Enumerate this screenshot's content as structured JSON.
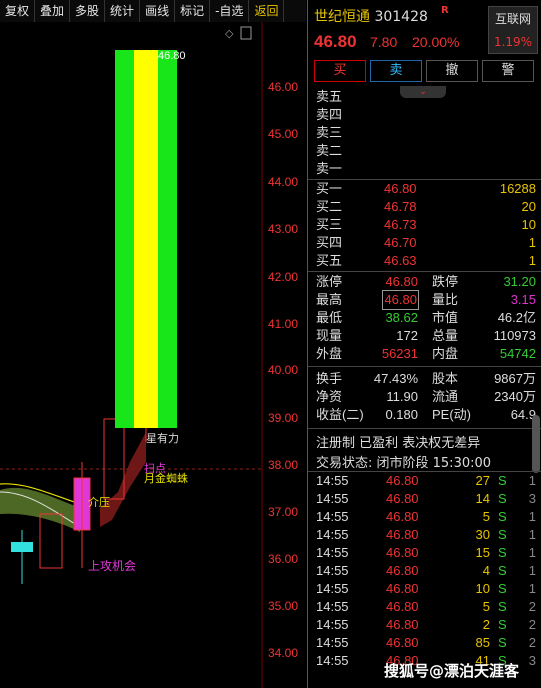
{
  "toolbar": {
    "items": [
      "复权",
      "叠加",
      "多股",
      "统计",
      "画线",
      "标记",
      "-自选"
    ],
    "back_label": "返回"
  },
  "chart": {
    "price_ticks": [
      "46.00",
      "45.00",
      "44.00",
      "43.00",
      "42.00",
      "41.00",
      "40.00",
      "39.00",
      "38.00",
      "37.00",
      "36.00",
      "35.00",
      "34.00"
    ],
    "last_price_label": "46.80",
    "annotations": {
      "star_power": "星有力",
      "golden_spider": "月金蜘蛛",
      "pressure": "介压",
      "attack_chance": "上攻机会",
      "point": "扫点"
    },
    "corner_icon": "◇"
  },
  "quote": {
    "name": "世纪恒通",
    "code": "301428",
    "badge": "R",
    "exchange": "互联网",
    "exchange_pct": "1.19%",
    "price": "46.80",
    "change": "7.80",
    "change_pct": "20.00%"
  },
  "actions": {
    "buy": "买",
    "sell": "卖",
    "cancel": "撤",
    "alert": "警"
  },
  "collapse_icon": "⌄",
  "asks": [
    "卖五",
    "卖四",
    "卖三",
    "卖二",
    "卖一"
  ],
  "bids": [
    {
      "label": "买一",
      "price": "46.80",
      "vol": "16288"
    },
    {
      "label": "买二",
      "price": "46.78",
      "vol": "20"
    },
    {
      "label": "买三",
      "price": "46.73",
      "vol": "10"
    },
    {
      "label": "买四",
      "price": "46.70",
      "vol": "1"
    },
    {
      "label": "买五",
      "price": "46.63",
      "vol": "1"
    }
  ],
  "stats": {
    "zhangting_label": "涨停",
    "zhangting": "46.80",
    "dieting_label": "跌停",
    "dieting": "31.20",
    "high_label": "最高",
    "high": "46.80",
    "liangbi_label": "量比",
    "liangbi": "3.15",
    "low_label": "最低",
    "low": "38.62",
    "shizhi_label": "市值",
    "shizhi": "46.2亿",
    "xianliang_label": "现量",
    "xianliang": "172",
    "zongliang_label": "总量",
    "zongliang": "110973",
    "waipan_label": "外盘",
    "waipan": "56231",
    "neipan_label": "内盘",
    "neipan": "54742",
    "huanshou_label": "换手",
    "huanshou": "47.43%",
    "guben_label": "股本",
    "guben": "9867万",
    "jingzi_label": "净资",
    "jingzi": "11.90",
    "liutong_label": "流通",
    "liutong": "2340万",
    "shouyi_label": "收益(二)",
    "shouyi": "0.180",
    "pe_label": "PE(动)",
    "pe": "64.9"
  },
  "tags": "注册制 已盈利 表决权无差异",
  "status": "交易状态: 闭市阶段 15:30:00",
  "ticks": [
    {
      "time": "14:55",
      "price": "46.80",
      "vol": "27",
      "dir": "S",
      "n": "1"
    },
    {
      "time": "14:55",
      "price": "46.80",
      "vol": "14",
      "dir": "S",
      "n": "3"
    },
    {
      "time": "14:55",
      "price": "46.80",
      "vol": "5",
      "dir": "S",
      "n": "1"
    },
    {
      "time": "14:55",
      "price": "46.80",
      "vol": "30",
      "dir": "S",
      "n": "1"
    },
    {
      "time": "14:55",
      "price": "46.80",
      "vol": "15",
      "dir": "S",
      "n": "1"
    },
    {
      "time": "14:55",
      "price": "46.80",
      "vol": "4",
      "dir": "S",
      "n": "1"
    },
    {
      "time": "14:55",
      "price": "46.80",
      "vol": "10",
      "dir": "S",
      "n": "1"
    },
    {
      "time": "14:55",
      "price": "46.80",
      "vol": "5",
      "dir": "S",
      "n": "2"
    },
    {
      "time": "14:55",
      "price": "46.80",
      "vol": "2",
      "dir": "S",
      "n": "2"
    },
    {
      "time": "14:55",
      "price": "46.80",
      "vol": "85",
      "dir": "S",
      "n": "2"
    },
    {
      "time": "14:55",
      "price": "46.80",
      "vol": "41",
      "dir": "S",
      "n": "3"
    }
  ],
  "watermark": "搜狐号@漂泊天涯客"
}
